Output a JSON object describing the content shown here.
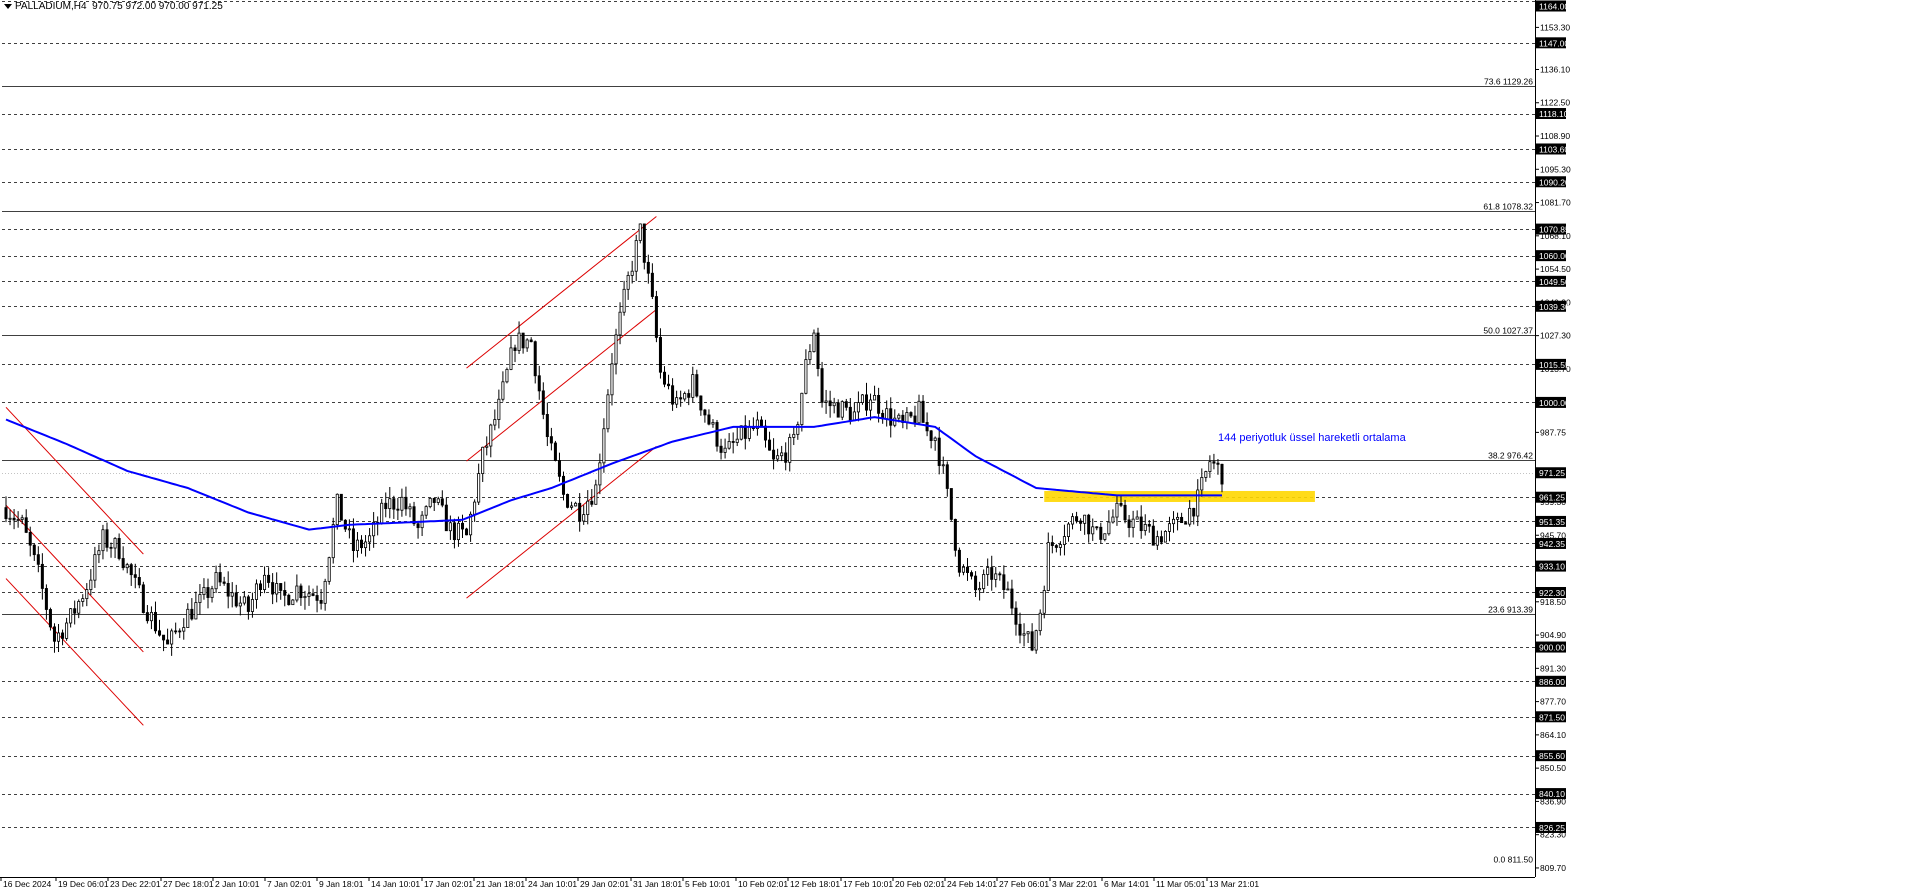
{
  "header": {
    "symbol": "PALLADIUM,H4",
    "ohlc": "970.75 972.00 970.00 971.25"
  },
  "colors": {
    "candle": "#000000",
    "ema": "#0000ff",
    "channel": "#dc0000",
    "zone": "#ffd700",
    "label_box": "#000000",
    "annotation": "#0000ff",
    "grid": "#000000"
  },
  "chart_data": {
    "type": "candlestick",
    "symbol": "PALLADIUM",
    "timeframe": "H4",
    "ylim": [
      806.0,
      1164.5
    ],
    "y_tick_labels": [
      "1153.30",
      "1136.10",
      "1122.50",
      "1108.90",
      "1095.30",
      "1081.70",
      "1068.10",
      "1054.50",
      "1040.90",
      "1027.30",
      "1013.70",
      "987.75",
      "959.30",
      "945.70",
      "932.10",
      "918.50",
      "904.90",
      "891.30",
      "877.70",
      "864.10",
      "850.50",
      "836.90",
      "823.30",
      "809.70"
    ],
    "x_tick_labels": [
      "16 Dec 2024",
      "19 Dec 06:01",
      "23 Dec 22:01",
      "27 Dec 18:01",
      "2 Jan 10:01",
      "7 Jan 02:01",
      "9 Jan 18:01",
      "14 Jan 10:01",
      "17 Jan 02:01",
      "21 Jan 18:01",
      "24 Jan 10:01",
      "29 Jan 02:01",
      "31 Jan 18:01",
      "5 Feb 10:01",
      "10 Feb 02:01",
      "12 Feb 18:01",
      "17 Feb 10:01",
      "20 Feb 02:01",
      "24 Feb 14:01",
      "27 Feb 06:01",
      "3 Mar 22:01",
      "6 Mar 14:01",
      "11 Mar 05:01",
      "13 Mar 21:01"
    ],
    "price_levels": [
      {
        "value": 1164.0,
        "label": "1164.00",
        "boxed": true
      },
      {
        "value": 1147.0,
        "label": "1147.00",
        "boxed": true
      },
      {
        "value": 1118.1,
        "label": "1118.10",
        "boxed": true
      },
      {
        "value": 1103.6,
        "label": "1103.60",
        "boxed": true
      },
      {
        "value": 1090.2,
        "label": "1090.20",
        "boxed": true
      },
      {
        "value": 1070.85,
        "label": "1070.85",
        "boxed": true
      },
      {
        "value": 1060.0,
        "label": "1060.00",
        "boxed": true
      },
      {
        "value": 1049.5,
        "label": "1049.50",
        "boxed": true
      },
      {
        "value": 1039.3,
        "label": "1039.30",
        "boxed": true
      },
      {
        "value": 1015.55,
        "label": "1015.55",
        "boxed": true
      },
      {
        "value": 1000.0,
        "label": "1000.00",
        "boxed": true
      },
      {
        "value": 961.25,
        "label": "961.25",
        "boxed": true
      },
      {
        "value": 951.35,
        "label": "951.35",
        "boxed": true
      },
      {
        "value": 942.35,
        "label": "942.35",
        "boxed": true
      },
      {
        "value": 933.1,
        "label": "933.10",
        "boxed": true
      },
      {
        "value": 922.3,
        "label": "922.30",
        "boxed": true
      },
      {
        "value": 900.0,
        "label": "900.00",
        "boxed": true
      },
      {
        "value": 886.0,
        "label": "886.00",
        "boxed": true
      },
      {
        "value": 871.5,
        "label": "871.50",
        "boxed": true
      },
      {
        "value": 855.6,
        "label": "855.60",
        "boxed": true
      },
      {
        "value": 840.1,
        "label": "840.10",
        "boxed": true
      },
      {
        "value": 826.25,
        "label": "826.25",
        "boxed": true
      }
    ],
    "current_price": {
      "value": 971.25,
      "label": "971.25"
    },
    "fibonacci": [
      {
        "value": 1129.26,
        "label": "73.6 1129.26"
      },
      {
        "value": 1078.32,
        "label": "61.8 1078.32"
      },
      {
        "value": 1027.37,
        "label": "50.0 1027.37"
      },
      {
        "value": 976.42,
        "label": "38.2 976.42"
      },
      {
        "value": 913.39,
        "label": "23.6 913.39"
      },
      {
        "value": 811.5,
        "label": "0.0 811.50"
      }
    ],
    "ema_label": "144 periyotluk üssel hareketli ortalama",
    "support_zone": {
      "low": 959.3,
      "high": 963.8,
      "from_bar": 257,
      "to_bar": 324
    },
    "trend_channels": [
      {
        "lines": [
          [
            0,
            928,
            34,
            868
          ],
          [
            0,
            958,
            34,
            898
          ],
          [
            0,
            998,
            34,
            938
          ]
        ]
      },
      {
        "lines": [
          [
            114,
            1014,
            161,
            1076
          ],
          [
            114,
            976,
            161,
            1038
          ],
          [
            114,
            920,
            161,
            982
          ]
        ]
      }
    ],
    "bar_count": 302,
    "ema_anchors": [
      [
        0,
        993
      ],
      [
        15,
        983
      ],
      [
        30,
        972
      ],
      [
        45,
        965
      ],
      [
        60,
        955
      ],
      [
        75,
        948
      ],
      [
        85,
        950
      ],
      [
        100,
        951
      ],
      [
        113,
        952
      ],
      [
        125,
        960
      ],
      [
        135,
        965
      ],
      [
        150,
        975
      ],
      [
        165,
        984
      ],
      [
        180,
        990
      ],
      [
        200,
        990
      ],
      [
        215,
        994
      ],
      [
        230,
        990
      ],
      [
        240,
        978
      ],
      [
        255,
        965
      ],
      [
        275,
        962
      ],
      [
        301,
        962
      ]
    ],
    "price_anchors": [
      [
        0,
        957
      ],
      [
        4,
        950
      ],
      [
        8,
        930
      ],
      [
        12,
        903
      ],
      [
        16,
        912
      ],
      [
        20,
        925
      ],
      [
        24,
        944
      ],
      [
        28,
        940
      ],
      [
        32,
        925
      ],
      [
        36,
        912
      ],
      [
        40,
        900
      ],
      [
        44,
        912
      ],
      [
        48,
        918
      ],
      [
        52,
        927
      ],
      [
        56,
        921
      ],
      [
        60,
        915
      ],
      [
        64,
        932
      ],
      [
        68,
        919
      ],
      [
        72,
        924
      ],
      [
        78,
        921
      ],
      [
        82,
        958
      ],
      [
        86,
        940
      ],
      [
        90,
        944
      ],
      [
        94,
        958
      ],
      [
        98,
        960
      ],
      [
        102,
        948
      ],
      [
        106,
        960
      ],
      [
        110,
        948
      ],
      [
        114,
        945
      ],
      [
        118,
        978
      ],
      [
        122,
        998
      ],
      [
        126,
        1025
      ],
      [
        130,
        1025
      ],
      [
        134,
        985
      ],
      [
        138,
        962
      ],
      [
        142,
        956
      ],
      [
        146,
        965
      ],
      [
        150,
        1018
      ],
      [
        154,
        1050
      ],
      [
        157,
        1070
      ],
      [
        160,
        1040
      ],
      [
        162,
        1012
      ],
      [
        166,
        998
      ],
      [
        170,
        1008
      ],
      [
        174,
        992
      ],
      [
        178,
        979
      ],
      [
        182,
        986
      ],
      [
        186,
        990
      ],
      [
        190,
        975
      ],
      [
        195,
        983
      ],
      [
        198,
        1015
      ],
      [
        200,
        1030
      ],
      [
        202,
        1000
      ],
      [
        206,
        998
      ],
      [
        210,
        995
      ],
      [
        214,
        1003
      ],
      [
        218,
        995
      ],
      [
        222,
        990
      ],
      [
        226,
        996
      ],
      [
        228,
        988
      ],
      [
        230,
        986
      ],
      [
        232,
        971
      ],
      [
        236,
        934
      ],
      [
        240,
        923
      ],
      [
        244,
        930
      ],
      [
        248,
        922
      ],
      [
        252,
        905
      ],
      [
        254,
        900
      ],
      [
        256,
        915
      ],
      [
        258,
        940
      ],
      [
        262,
        948
      ],
      [
        266,
        955
      ],
      [
        270,
        945
      ],
      [
        275,
        955
      ],
      [
        280,
        950
      ],
      [
        285,
        945
      ],
      [
        290,
        950
      ],
      [
        295,
        960
      ],
      [
        298,
        976
      ],
      [
        301,
        971
      ]
    ]
  },
  "y_labels": {
    "l1153": "1153.30",
    "l1136": "1136.10",
    "l1122": "1122.50",
    "l1108": "1108.90",
    "l1095": "1095.30",
    "l1081": "1081.70",
    "l1068": "1068.10",
    "l1054": "1054.50",
    "l1040": "1040.90",
    "l1027": "1027.30",
    "l1013": "1013.70",
    "l959": "959.30",
    "l945": "945.70",
    "l932": "932.10",
    "l918": "918.50",
    "l904": "904.90",
    "l891": "891.30",
    "l877": "877.70",
    "l864": "864.10",
    "l850": "850.50",
    "l836": "836.90",
    "l823": "823.30",
    "l809": "809.70"
  }
}
